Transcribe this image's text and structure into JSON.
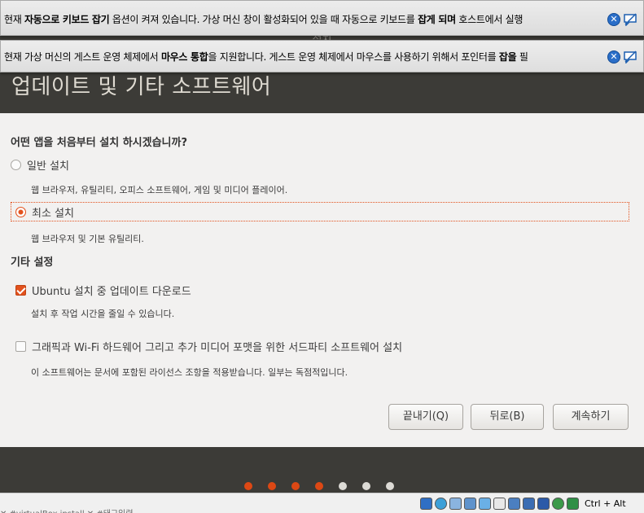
{
  "header": {
    "ghost_title": "설치",
    "heading": "업데이트 및 기타 소프트웨어"
  },
  "notices": [
    {
      "parts": [
        {
          "t": "현재 ",
          "b": false
        },
        {
          "t": "자동으로 키보드 잡기",
          "b": true
        },
        {
          "t": " 옵션이 켜져 있습니다. 가상 머신 창이 활성화되어 있을 때 자동으로 키보드를 ",
          "b": false
        },
        {
          "t": "잡게 되며",
          "b": true
        },
        {
          "t": " 호스트에서 실행",
          "b": false
        }
      ]
    },
    {
      "parts": [
        {
          "t": "현재 가상 머신의 게스트 운영 체제에서 ",
          "b": false
        },
        {
          "t": "마우스 통합",
          "b": true
        },
        {
          "t": "을 지원합니다. 게스트 운영 체제에서 마우스를 사용하기 위해서 포인터를 ",
          "b": false
        },
        {
          "t": "잡을",
          "b": true
        },
        {
          "t": " 필",
          "b": false
        }
      ]
    }
  ],
  "question": "어떤 앱을 처음부터 설치 하시겠습니까?",
  "install_options": [
    {
      "label": "일반 설치",
      "desc": "웹 브라우저, 유틸리티, 오피스 소프트웨어, 게임 및 미디어 플레이어.",
      "selected": false
    },
    {
      "label": "최소 설치",
      "desc": "웹 브라우저 및 기본 유틸리티.",
      "selected": true
    }
  ],
  "other_section": "기타 설정",
  "other_options": [
    {
      "label": "Ubuntu 설치 중 업데이트 다운로드",
      "desc": "설치 후 작업 시간을 줄일 수 있습니다.",
      "checked": true
    },
    {
      "label": "그래픽과 Wi-Fi 하드웨어 그리고 추가 미디어 포맷을 위한 서드파티 소프트웨어 설치",
      "desc": "이 소프트웨어는 문서에 포함된 라이선스 조항을 적용받습니다. 일부는 독점적입니다.",
      "checked": false
    }
  ],
  "buttons": {
    "quit": "끝내기(Q)",
    "back": "뒤로(B)",
    "continue": "계속하기"
  },
  "progress": {
    "total": 7,
    "completed": 4
  },
  "statusbar": {
    "behind_text": "✕  #virtualBox install ✕  #태그입력",
    "host_key": "Ctrl + Alt"
  },
  "colors": {
    "accent": "#dd4814",
    "dark_band": "#3c3b37",
    "background": "#f2f1f0"
  }
}
